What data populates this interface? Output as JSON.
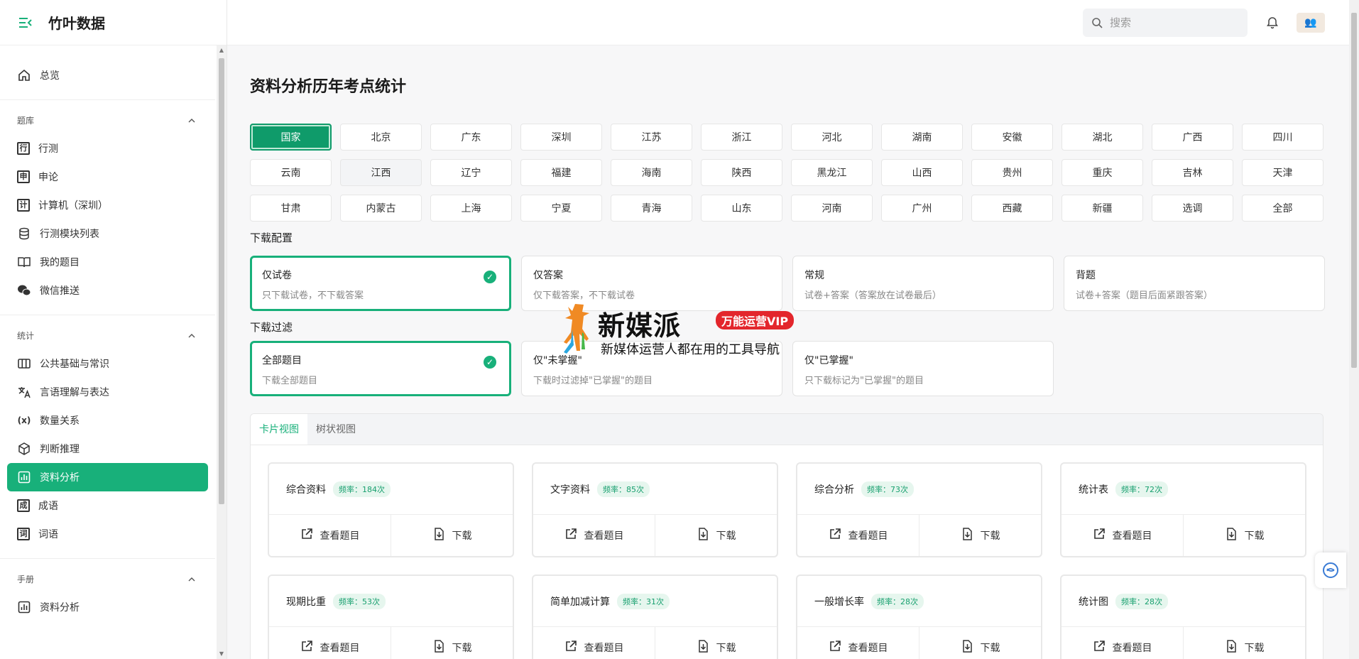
{
  "brand": {
    "title": "竹叶数据"
  },
  "search": {
    "placeholder": "搜索"
  },
  "sidebar": {
    "overview": "总览",
    "sections": [
      {
        "title": "题库",
        "items": [
          {
            "label": "行测",
            "icon": "行"
          },
          {
            "label": "申论",
            "icon": "申"
          },
          {
            "label": "计算机（深圳）",
            "icon": "计"
          },
          {
            "label": "行测模块列表",
            "icon": "database-icon"
          },
          {
            "label": "我的题目",
            "icon": "book-icon"
          },
          {
            "label": "微信推送",
            "icon": "wechat-icon"
          }
        ]
      },
      {
        "title": "统计",
        "items": [
          {
            "label": "公共基础与常识",
            "icon": "columns-icon"
          },
          {
            "label": "言语理解与表达",
            "icon": "translate-icon"
          },
          {
            "label": "数量关系",
            "icon": "(x)"
          },
          {
            "label": "判断推理",
            "icon": "cube-icon"
          },
          {
            "label": "资料分析",
            "icon": "chart-icon",
            "active": true
          },
          {
            "label": "成语",
            "icon": "成"
          },
          {
            "label": "词语",
            "icon": "词"
          }
        ]
      },
      {
        "title": "手册",
        "items": [
          {
            "label": "资料分析",
            "icon": "chart-icon"
          }
        ]
      }
    ]
  },
  "main": {
    "title": "资料分析历年考点统计",
    "regions": [
      "国家",
      "北京",
      "广东",
      "深圳",
      "江苏",
      "浙江",
      "河北",
      "湖南",
      "安徽",
      "湖北",
      "广西",
      "四川",
      "云南",
      "江西",
      "辽宁",
      "福建",
      "海南",
      "陕西",
      "黑龙江",
      "山西",
      "贵州",
      "重庆",
      "吉林",
      "天津",
      "甘肃",
      "内蒙古",
      "上海",
      "宁夏",
      "青海",
      "山东",
      "河南",
      "广州",
      "西藏",
      "新疆",
      "选调",
      "全部"
    ],
    "selected_region": "国家",
    "download_config_label": "下载配置",
    "download_config": [
      {
        "title": "仅试卷",
        "desc": "只下载试卷，不下载答案",
        "checked": true
      },
      {
        "title": "仅答案",
        "desc": "仅下载答案，不下载试卷",
        "checked": false
      },
      {
        "title": "常规",
        "desc": "试卷+答案（答案放在试卷最后）",
        "checked": false
      },
      {
        "title": "背题",
        "desc": "试卷+答案（题目后面紧跟答案）",
        "checked": false
      }
    ],
    "download_filter_label": "下载过滤",
    "download_filter": [
      {
        "title": "全部题目",
        "desc": "下载全部题目",
        "checked": true
      },
      {
        "title": "仅\"未掌握\"",
        "desc": "下载时过滤掉\"已掌握\"的题目",
        "checked": false
      },
      {
        "title": "仅\"已掌握\"",
        "desc": "只下载标记为\"已掌握\"的题目",
        "checked": false
      }
    ],
    "tabs": [
      "卡片视图",
      "树状视图"
    ],
    "card_actions": {
      "view": "查看题目",
      "download": "下载"
    },
    "cards": [
      {
        "name": "综合资料",
        "freq": "频率：184次"
      },
      {
        "name": "文字资料",
        "freq": "频率：85次"
      },
      {
        "name": "综合分析",
        "freq": "频率：73次"
      },
      {
        "name": "统计表",
        "freq": "频率：72次"
      },
      {
        "name": "现期比重",
        "freq": "频率：53次"
      },
      {
        "name": "简单加减计算",
        "freq": "频率：31次"
      },
      {
        "name": "一般增长率",
        "freq": "频率：28次"
      },
      {
        "name": "统计图",
        "freq": "频率：28次"
      }
    ]
  },
  "watermark": {
    "brand": "新媒派",
    "badge": "万能运营VIP",
    "slogan": "新媒体运营人都在用的工具导航"
  },
  "colors": {
    "accent": "#18b07a",
    "selected": "#0f9b6a"
  }
}
